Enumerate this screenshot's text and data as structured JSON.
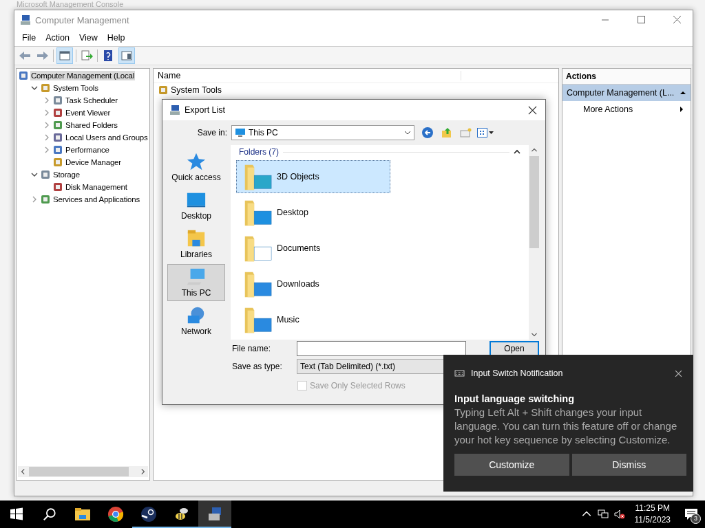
{
  "background_window": {
    "title": "Microsoft Management Console"
  },
  "window": {
    "title": "Computer Management",
    "menu": [
      "File",
      "Action",
      "View",
      "Help"
    ],
    "tree": [
      {
        "label": "Computer Management (Local",
        "selected": true,
        "children": [
          {
            "label": "System Tools",
            "selected": false,
            "expanded": true,
            "children": [
              {
                "label": "Task Scheduler",
                "selected": false,
                "expanded": false
              },
              {
                "label": "Event Viewer",
                "selected": false,
                "expanded": false
              },
              {
                "label": "Shared Folders",
                "selected": false,
                "expanded": false
              },
              {
                "label": "Local Users and Groups",
                "selected": false,
                "expanded": false
              },
              {
                "label": "Performance",
                "selected": false,
                "expanded": false
              },
              {
                "label": "Device Manager",
                "selected": false
              }
            ]
          },
          {
            "label": "Storage",
            "selected": false,
            "expanded": true,
            "children": [
              {
                "label": "Disk Management",
                "selected": false
              }
            ]
          },
          {
            "label": "Services and Applications",
            "selected": false,
            "expanded": false
          }
        ]
      }
    ],
    "list": {
      "columns": [
        "Name"
      ],
      "rows": [
        "System Tools"
      ]
    },
    "actions": {
      "title": "Actions",
      "section": "Computer Management (L...",
      "items": [
        "More Actions"
      ]
    }
  },
  "dialog": {
    "title": "Export List",
    "save_in_label": "Save in:",
    "save_in": "This PC",
    "places": [
      {
        "label": "Quick access",
        "selected": false
      },
      {
        "label": "Desktop",
        "selected": false
      },
      {
        "label": "Libraries",
        "selected": false
      },
      {
        "label": "This PC",
        "selected": true
      },
      {
        "label": "Network",
        "selected": false
      }
    ],
    "group": "Folders (7)",
    "folders": [
      {
        "name": "3D Objects",
        "selected": true
      },
      {
        "name": "Desktop",
        "selected": false
      },
      {
        "name": "Documents",
        "selected": false
      },
      {
        "name": "Downloads",
        "selected": false
      },
      {
        "name": "Music",
        "selected": false
      }
    ],
    "file_name_label": "File name:",
    "save_type_label": "Save as type:",
    "save_type": "Text (Tab Delimited) (*.txt)",
    "open_button": "Open",
    "save_only_selected": {
      "label": "Save Only Selected Rows",
      "checked": false,
      "disabled": true
    }
  },
  "notification": {
    "app": "Input Switch Notification",
    "title": "Input language switching",
    "body": "Typing Left Alt + Shift changes your input language. You can turn this feature off or change your hot key sequence by selecting Customize.",
    "buttons": [
      "Customize",
      "Dismiss"
    ]
  },
  "taskbar": {
    "apps": [
      {
        "kind": "explorer",
        "running": false,
        "active": false
      },
      {
        "kind": "chrome",
        "running": false,
        "active": false
      },
      {
        "kind": "steam",
        "running": true,
        "active": false
      },
      {
        "kind": "bee",
        "running": true,
        "active": false
      },
      {
        "kind": "console",
        "running": true,
        "active": true
      }
    ],
    "time": "11:25 PM",
    "date": "11/5/2023",
    "notification_count": "3"
  }
}
